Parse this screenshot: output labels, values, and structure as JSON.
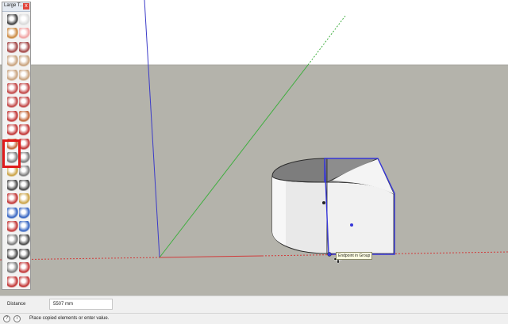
{
  "toolbar": {
    "title": "Large T...",
    "close_glyph": "x",
    "tools": [
      {
        "name": "select-icon",
        "col": "#3b3b3b"
      },
      {
        "name": "eraser-icon",
        "col": "#d9d9d9"
      },
      {
        "name": "paint-bucket-icon",
        "col": "#c9853b"
      },
      {
        "name": "eraser-pink-icon",
        "col": "#f0a0a0"
      },
      {
        "name": "line-icon",
        "col": "#a04040"
      },
      {
        "name": "freehand-icon",
        "col": "#a04040"
      },
      {
        "name": "rectangle-icon",
        "col": "#c7a07a"
      },
      {
        "name": "rotated-rectangle-icon",
        "col": "#c7a07a"
      },
      {
        "name": "circle-icon",
        "col": "#c7a07a"
      },
      {
        "name": "polygon-icon",
        "col": "#c7a07a"
      },
      {
        "name": "arc-icon",
        "col": "#c04040"
      },
      {
        "name": "arc-2pt-icon",
        "col": "#c04040"
      },
      {
        "name": "arc-3pt-icon",
        "col": "#c04040"
      },
      {
        "name": "pie-icon",
        "col": "#c04040"
      },
      {
        "name": "move-icon",
        "col": "#c03030"
      },
      {
        "name": "push-pull-icon",
        "col": "#c06030"
      },
      {
        "name": "rotate-icon",
        "col": "#c03030"
      },
      {
        "name": "follow-me-icon",
        "col": "#c03030"
      },
      {
        "name": "scale-icon",
        "col": "#c06030"
      },
      {
        "name": "offset-icon",
        "col": "#c03030"
      },
      {
        "name": "tape-measure-icon",
        "col": "#777777"
      },
      {
        "name": "dimension-icon",
        "col": "#777777"
      },
      {
        "name": "protractor-icon",
        "col": "#c9a040"
      },
      {
        "name": "text-icon",
        "col": "#777777"
      },
      {
        "name": "axes-icon",
        "col": "#444444"
      },
      {
        "name": "3d-text-icon",
        "col": "#444444"
      },
      {
        "name": "orbit-icon",
        "col": "#c03030"
      },
      {
        "name": "pan-icon",
        "col": "#c9a040"
      },
      {
        "name": "zoom-icon",
        "col": "#3060c0"
      },
      {
        "name": "zoom-window-icon",
        "col": "#3060c0"
      },
      {
        "name": "zoom-extents-icon",
        "col": "#c03030"
      },
      {
        "name": "previous-view-icon",
        "col": "#3060c0"
      },
      {
        "name": "position-camera-icon",
        "col": "#777777"
      },
      {
        "name": "look-around-icon",
        "col": "#444444"
      },
      {
        "name": "walk-icon",
        "col": "#444444"
      },
      {
        "name": "section-plane-icon",
        "col": "#444444"
      },
      {
        "name": "sandbox-icon",
        "col": "#777777"
      },
      {
        "name": "warehouse-icon",
        "col": "#c03030"
      },
      {
        "name": "extension-icon",
        "col": "#c03030"
      },
      {
        "name": "share-icon",
        "col": "#c03030"
      }
    ]
  },
  "canvas": {
    "sky_color": "#ffffff",
    "ground_color": "#b4b3ab",
    "red_axis_color": "#d13b3b",
    "green_axis_color": "#3fae3f",
    "blue_axis_color": "#3c3cc8",
    "selection_color": "#3636d8",
    "tooltip_text": "Endpoint in Group"
  },
  "status": {
    "vcb_label": "Distance",
    "vcb_value": "5507 mm",
    "info_icon": "i",
    "geo_icon": "?",
    "message": "Place copied elements or enter value."
  }
}
